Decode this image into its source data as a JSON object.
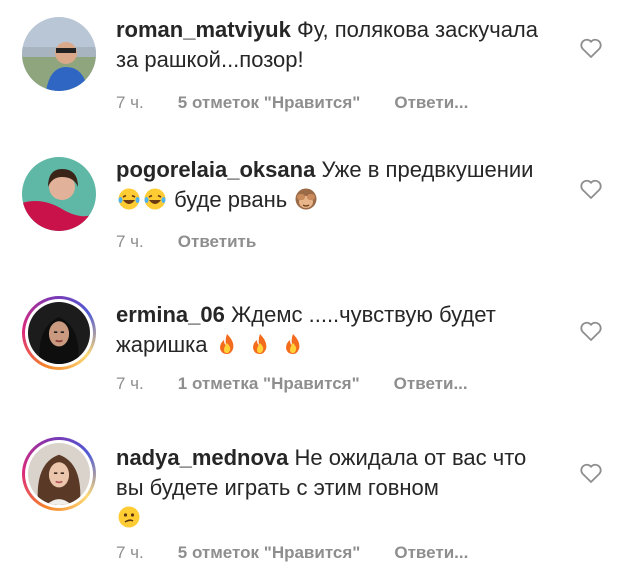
{
  "comments": [
    {
      "username": "roman_matviyuk",
      "text": "Фу, полякова заскучала за рашкой...позор!",
      "time": "7 ч.",
      "likes": "5 отметок \"Нравится\"",
      "reply": "Ответи..."
    },
    {
      "username": "pogorelaia_oksana",
      "text": "Уже в предвкушении",
      "text_after": "буде рвань",
      "emojis_mid": [
        "laughing-tears",
        "laughing-tears"
      ],
      "emoji_end": "see-no-evil-monkey",
      "time": "7 ч.",
      "reply": "Ответить"
    },
    {
      "username": "ermina_06",
      "text": "Ждемс .....чувствую будет жаришка",
      "emojis_end": [
        "fire",
        "fire",
        "fire"
      ],
      "time": "7 ч.",
      "likes": "1 отметка \"Нравится\"",
      "reply": "Ответи..."
    },
    {
      "username": "nadya_mednova",
      "text": "Не ожидала от вас что вы будете играть с этим говном",
      "emoji_end": "confused-face",
      "time": "7 ч.",
      "likes": "5 отметок \"Нравится\"",
      "reply": "Ответи..."
    }
  ],
  "icons": {
    "like": "heart-outline-icon"
  },
  "colors": {
    "text": "#262626",
    "meta": "#8e8e8e"
  }
}
